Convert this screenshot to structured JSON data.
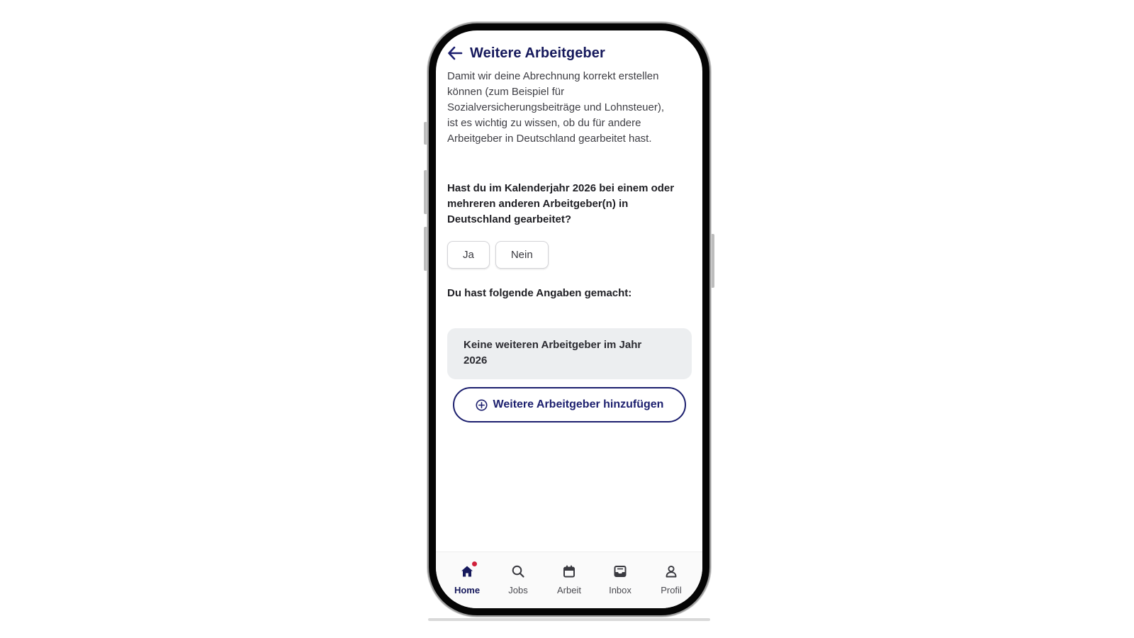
{
  "header": {
    "title": "Weitere Arbeitgeber",
    "back_icon": "arrow-left-icon"
  },
  "intro": {
    "text": "Damit wir deine Abrechnung korrekt erstellen können (zum Beispiel für Sozialversicherungsbeiträge und Lohnsteuer), ist es wichtig zu wissen, ob du für andere Arbeitgeber in Deutschland gearbeitet hast."
  },
  "question": {
    "text": "Hast du im Kalenderjahr 2026 bei einem oder mehreren anderen Arbeitgeber(n) in Deutschland gearbeitet?",
    "options": [
      {
        "label": "Ja"
      },
      {
        "label": "Nein"
      }
    ]
  },
  "summary": {
    "label": "Du hast folgende Angaben gemacht:",
    "entry": "Keine weiteren Arbeitgeber im Jahr 2026"
  },
  "add_button": {
    "label": "Weitere Arbeitgeber hinzufügen",
    "icon": "plus-circle-icon"
  },
  "bottom_nav": {
    "items": [
      {
        "label": "Home",
        "icon": "home-icon",
        "active": true,
        "badge": true
      },
      {
        "label": "Jobs",
        "icon": "search-icon",
        "active": false
      },
      {
        "label": "Arbeit",
        "icon": "calendar-icon",
        "active": false
      },
      {
        "label": "Inbox",
        "icon": "inbox-icon",
        "active": false
      },
      {
        "label": "Profil",
        "icon": "person-icon",
        "active": false
      }
    ]
  },
  "colors": {
    "primary": "#1c1f6e",
    "title": "#16195c",
    "badge": "#d0203a",
    "card_bg": "#eceef0"
  }
}
